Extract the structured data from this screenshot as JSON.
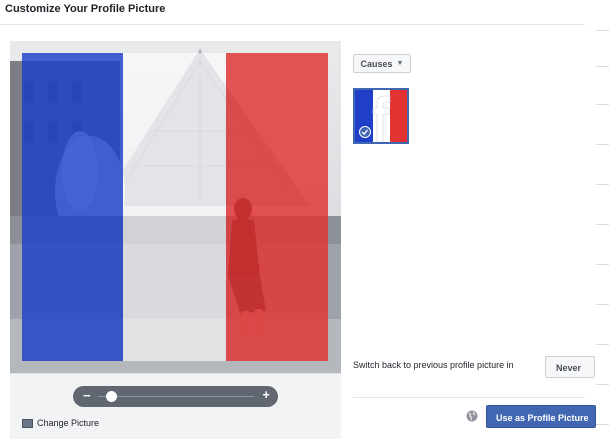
{
  "header": {
    "title": "Customize Your Profile Picture"
  },
  "editor": {
    "slider": {
      "minus_label": "−",
      "plus_label": "+",
      "zoom_level": 0.1
    },
    "change_picture_label": "Change Picture"
  },
  "frames": {
    "category_button_label": "Causes",
    "selected_frame": {
      "icon": "facebook-france-flag-frame",
      "selected": true
    }
  },
  "switch_back": {
    "label": "Switch back to previous profile picture in",
    "value": "Never"
  },
  "actions": {
    "primary_label": "Use as Profile Picture",
    "privacy_icon": "globe-icon"
  },
  "colors": {
    "flag_blue": "#1f3fc8",
    "flag_red": "#e23232",
    "accent": "#4267b2"
  }
}
